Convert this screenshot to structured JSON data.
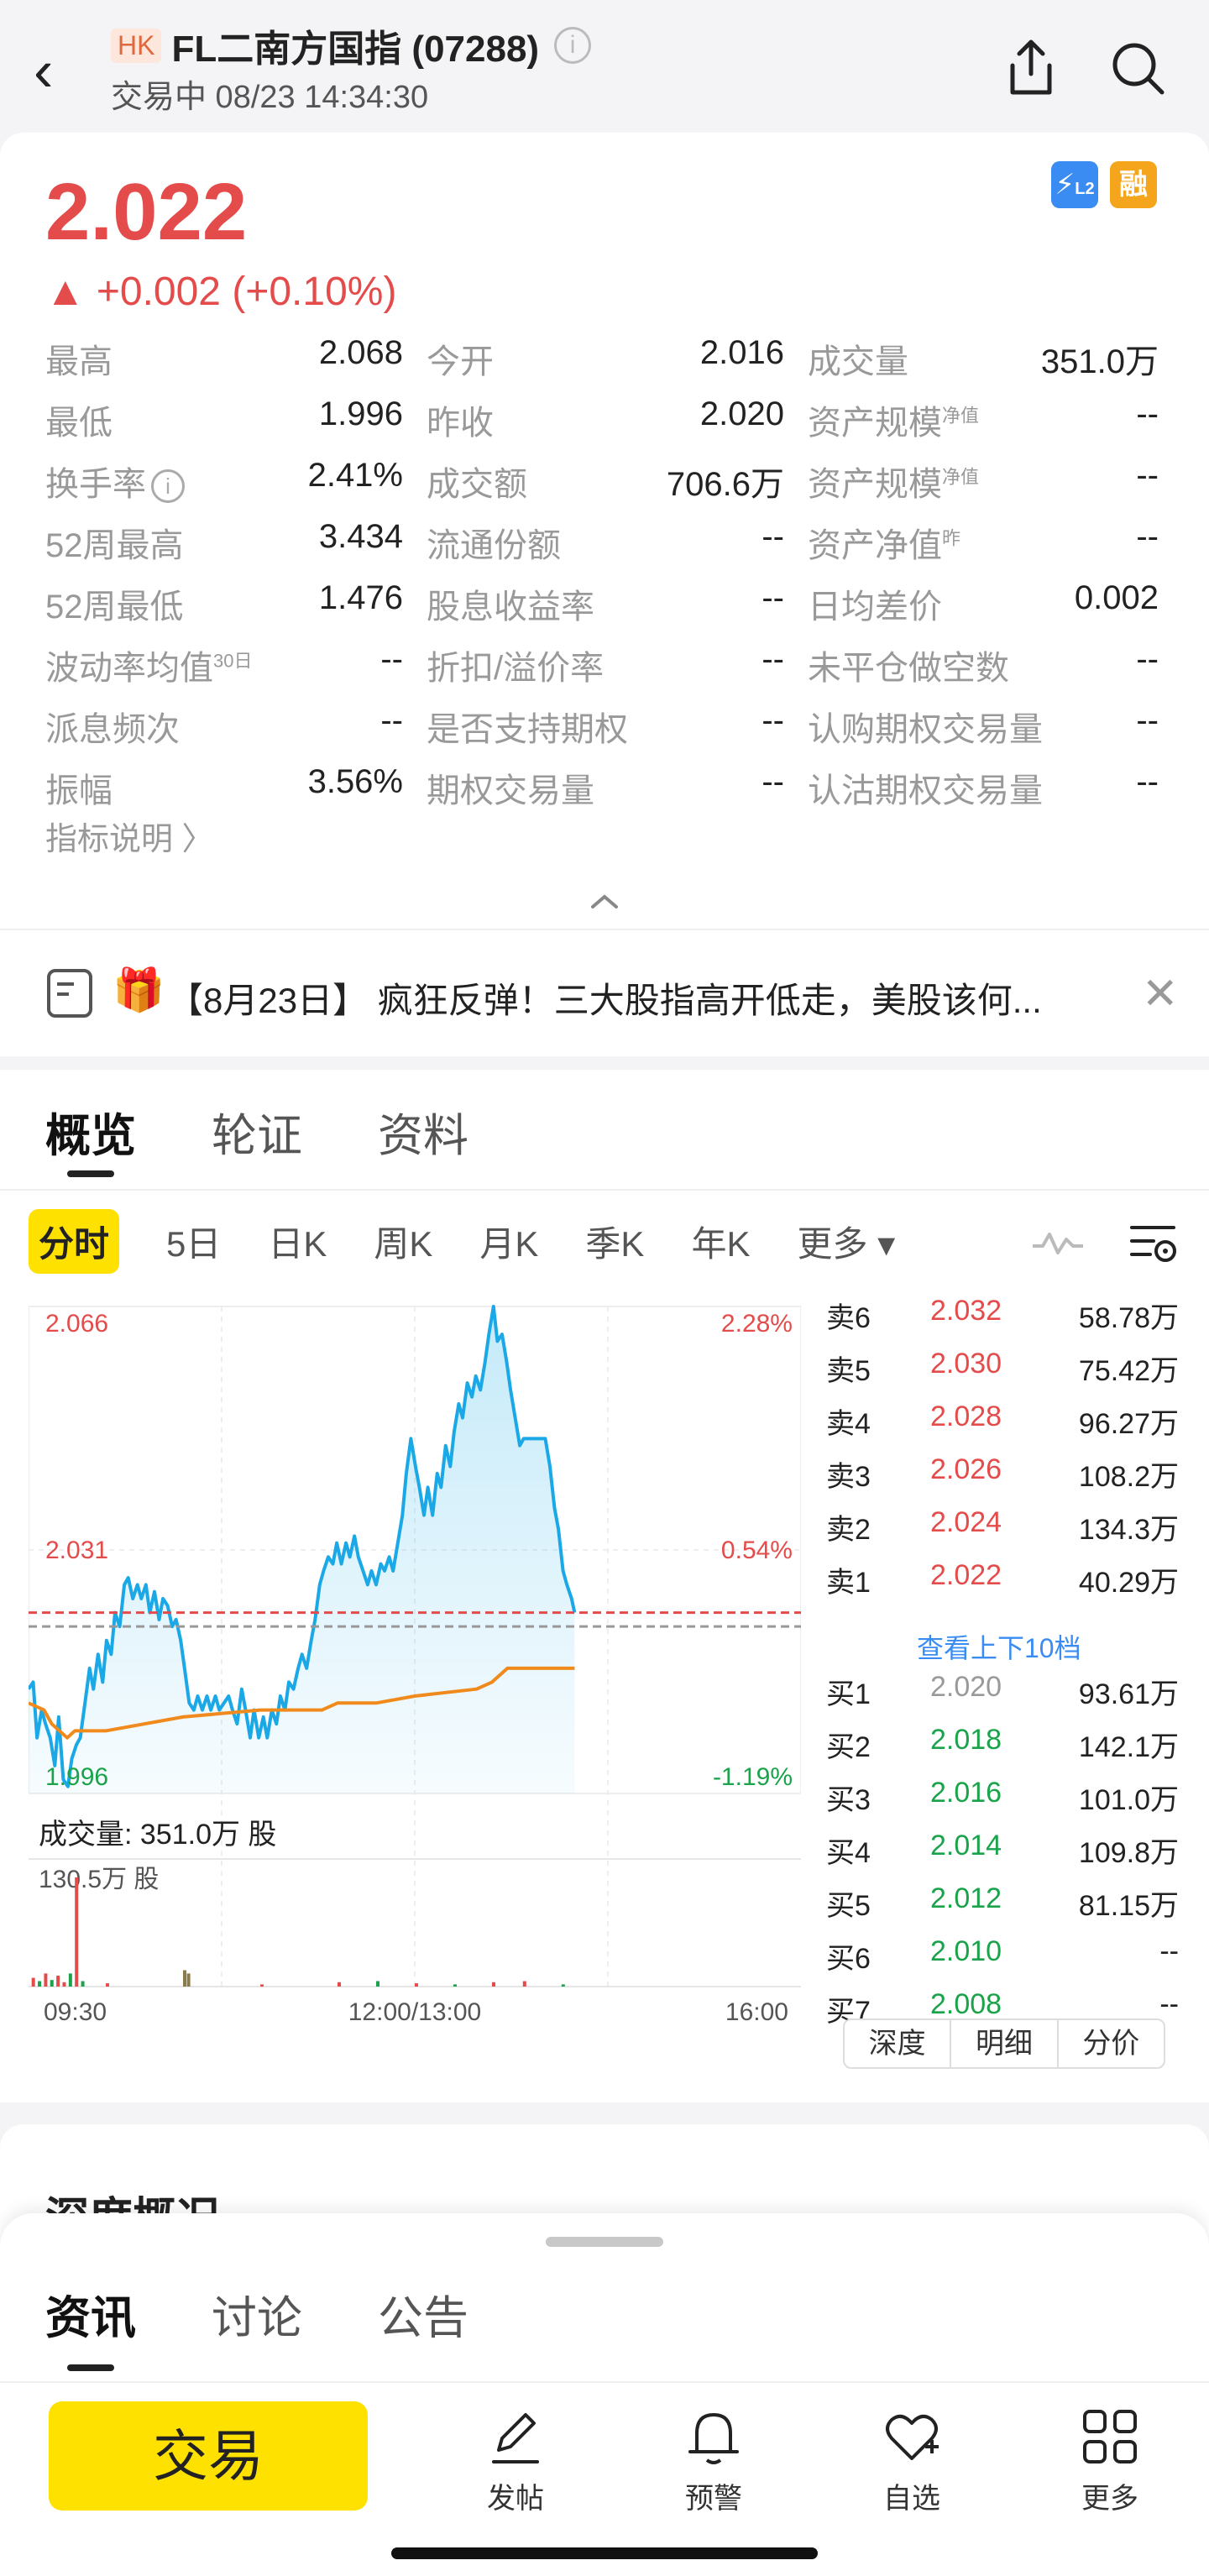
{
  "header": {
    "market_badge": "HK",
    "title": "FL二南方国指 (07288)",
    "status": "交易中 08/23 14:34:30"
  },
  "quote": {
    "price": "2.022",
    "change": "▲ +0.002 (+0.10%)",
    "badge_l2": "L2",
    "badge_margin": "融",
    "color_up": "#e44b4b",
    "color_down": "#1aa34a"
  },
  "stats": [
    [
      {
        "label": "最高",
        "value": "2.068"
      },
      {
        "label": "今开",
        "value": "2.016"
      },
      {
        "label": "成交量",
        "value": "351.0万"
      }
    ],
    [
      {
        "label": "最低",
        "value": "1.996"
      },
      {
        "label": "昨收",
        "value": "2.020"
      },
      {
        "label": "资产规模",
        "sup": "净值",
        "value": "--"
      }
    ],
    [
      {
        "label": "换手率",
        "value": "2.41%"
      },
      {
        "label": "成交额",
        "value": "706.6万"
      },
      {
        "label": "资产规模",
        "sup": "净值",
        "value": "--"
      }
    ],
    [
      {
        "label": "52周最高",
        "value": "3.434"
      },
      {
        "label": "流通份额",
        "value": "--"
      },
      {
        "label": "资产净值",
        "sup": "昨",
        "value": "--"
      }
    ],
    [
      {
        "label": "52周最低",
        "value": "1.476"
      },
      {
        "label": "股息收益率",
        "value": "--"
      },
      {
        "label": "日均差价",
        "value": "0.002"
      }
    ],
    [
      {
        "label": "波动率均值",
        "sup": "30日",
        "value": "--"
      },
      {
        "label": "折扣/溢价率",
        "value": "--"
      },
      {
        "label": "未平仓做空数",
        "value": "--"
      }
    ],
    [
      {
        "label": "派息频次",
        "value": "--"
      },
      {
        "label": "是否支持期权",
        "value": "--"
      },
      {
        "label": "认购期权交易量",
        "value": "--"
      }
    ],
    [
      {
        "label": "振幅",
        "value": "3.56%"
      },
      {
        "label": "期权交易量",
        "value": "--"
      },
      {
        "label": "认沽期权交易量",
        "value": "--"
      }
    ]
  ],
  "indicator_link": "指标说明 〉",
  "news": {
    "text": "【8月23日】 疯狂反弹！三大股指高开低走，美股该何..."
  },
  "tabs": [
    "概览",
    "轮证",
    "资料"
  ],
  "periods": [
    "分时",
    "5日",
    "日K",
    "周K",
    "月K",
    "季K",
    "年K"
  ],
  "period_more": "更多 ▾",
  "chart_data": {
    "type": "line",
    "title": "",
    "price_axis": {
      "max": "2.066",
      "mid": "2.031",
      "min": "1.996"
    },
    "pct_axis": {
      "max": "2.28%",
      "mid": "0.54%",
      "min": "-1.19%"
    },
    "ylim": [
      1.996,
      2.066
    ],
    "prev_close": 2.02,
    "current": 2.022,
    "x_ticks": [
      "09:30",
      "12:00/13:00",
      "16:00"
    ],
    "volume_label": "成交量: 351.0万 股",
    "volume_max_label": "130.5万 股",
    "price_series": [
      [
        0,
        2.011
      ],
      [
        0.006,
        2.012
      ],
      [
        0.011,
        2.004
      ],
      [
        0.017,
        2.008
      ],
      [
        0.022,
        2.006
      ],
      [
        0.028,
        2.004
      ],
      [
        0.034,
        2.0
      ],
      [
        0.039,
        2.007
      ],
      [
        0.045,
        1.998
      ],
      [
        0.051,
        1.997
      ],
      [
        0.056,
        2.001
      ],
      [
        0.062,
        2.003
      ],
      [
        0.067,
        2.004
      ],
      [
        0.073,
        2.009
      ],
      [
        0.079,
        2.014
      ],
      [
        0.084,
        2.011
      ],
      [
        0.09,
        2.016
      ],
      [
        0.096,
        2.012
      ],
      [
        0.101,
        2.018
      ],
      [
        0.107,
        2.016
      ],
      [
        0.112,
        2.022
      ],
      [
        0.118,
        2.02
      ],
      [
        0.124,
        2.026
      ],
      [
        0.129,
        2.027
      ],
      [
        0.135,
        2.024
      ],
      [
        0.141,
        2.026
      ],
      [
        0.146,
        2.024
      ],
      [
        0.152,
        2.026
      ],
      [
        0.157,
        2.022
      ],
      [
        0.163,
        2.025
      ],
      [
        0.169,
        2.021
      ],
      [
        0.174,
        2.024
      ],
      [
        0.18,
        2.023
      ],
      [
        0.186,
        2.02
      ],
      [
        0.191,
        2.021
      ],
      [
        0.197,
        2.018
      ],
      [
        0.202,
        2.014
      ],
      [
        0.208,
        2.009
      ],
      [
        0.214,
        2.008
      ],
      [
        0.219,
        2.01
      ],
      [
        0.225,
        2.008
      ],
      [
        0.231,
        2.01
      ],
      [
        0.236,
        2.008
      ],
      [
        0.242,
        2.01
      ],
      [
        0.247,
        2.008
      ],
      [
        0.253,
        2.009
      ],
      [
        0.259,
        2.01
      ],
      [
        0.264,
        2.008
      ],
      [
        0.27,
        2.006
      ],
      [
        0.276,
        2.011
      ],
      [
        0.281,
        2.008
      ],
      [
        0.287,
        2.004
      ],
      [
        0.292,
        2.008
      ],
      [
        0.298,
        2.004
      ],
      [
        0.304,
        2.007
      ],
      [
        0.309,
        2.004
      ],
      [
        0.315,
        2.008
      ],
      [
        0.321,
        2.006
      ],
      [
        0.326,
        2.01
      ],
      [
        0.332,
        2.008
      ],
      [
        0.337,
        2.012
      ],
      [
        0.343,
        2.011
      ],
      [
        0.349,
        2.014
      ],
      [
        0.354,
        2.016
      ],
      [
        0.36,
        2.014
      ],
      [
        0.366,
        2.018
      ],
      [
        0.371,
        2.021
      ],
      [
        0.377,
        2.026
      ],
      [
        0.382,
        2.028
      ],
      [
        0.388,
        2.03
      ],
      [
        0.394,
        2.029
      ],
      [
        0.399,
        2.032
      ],
      [
        0.405,
        2.029
      ],
      [
        0.411,
        2.032
      ],
      [
        0.416,
        2.03
      ],
      [
        0.422,
        2.033
      ],
      [
        0.427,
        2.03
      ],
      [
        0.433,
        2.028
      ],
      [
        0.439,
        2.026
      ],
      [
        0.444,
        2.028
      ],
      [
        0.45,
        2.026
      ],
      [
        0.456,
        2.029
      ],
      [
        0.461,
        2.028
      ],
      [
        0.467,
        2.03
      ],
      [
        0.472,
        2.028
      ],
      [
        0.478,
        2.032
      ],
      [
        0.484,
        2.036
      ],
      [
        0.489,
        2.042
      ],
      [
        0.495,
        2.047
      ],
      [
        0.501,
        2.043
      ],
      [
        0.506,
        2.04
      ],
      [
        0.512,
        2.036
      ],
      [
        0.517,
        2.04
      ],
      [
        0.523,
        2.036
      ],
      [
        0.529,
        2.042
      ],
      [
        0.534,
        2.04
      ],
      [
        0.54,
        2.046
      ],
      [
        0.546,
        2.043
      ],
      [
        0.551,
        2.048
      ],
      [
        0.557,
        2.052
      ],
      [
        0.562,
        2.05
      ],
      [
        0.568,
        2.055
      ],
      [
        0.574,
        2.053
      ],
      [
        0.579,
        2.056
      ],
      [
        0.585,
        2.054
      ],
      [
        0.591,
        2.058
      ],
      [
        0.596,
        2.062
      ],
      [
        0.602,
        2.066
      ],
      [
        0.607,
        2.061
      ],
      [
        0.613,
        2.062
      ],
      [
        0.619,
        2.058
      ],
      [
        0.624,
        2.054
      ],
      [
        0.63,
        2.05
      ],
      [
        0.636,
        2.046
      ],
      [
        0.641,
        2.047
      ],
      [
        0.647,
        2.047
      ],
      [
        0.652,
        2.047
      ],
      [
        0.658,
        2.047
      ],
      [
        0.664,
        2.047
      ],
      [
        0.669,
        2.047
      ],
      [
        0.675,
        2.043
      ],
      [
        0.681,
        2.037
      ],
      [
        0.686,
        2.034
      ],
      [
        0.692,
        2.028
      ],
      [
        0.697,
        2.026
      ],
      [
        0.703,
        2.024
      ],
      [
        0.707,
        2.022
      ]
    ],
    "avg_series": [
      [
        0,
        2.009
      ],
      [
        0.02,
        2.008
      ],
      [
        0.03,
        2.006
      ],
      [
        0.05,
        2.004
      ],
      [
        0.06,
        2.005
      ],
      [
        0.1,
        2.005
      ],
      [
        0.2,
        2.007
      ],
      [
        0.3,
        2.008
      ],
      [
        0.38,
        2.008
      ],
      [
        0.4,
        2.009
      ],
      [
        0.45,
        2.009
      ],
      [
        0.5,
        2.01
      ],
      [
        0.58,
        2.011
      ],
      [
        0.6,
        2.012
      ],
      [
        0.62,
        2.014
      ],
      [
        0.707,
        2.014
      ]
    ],
    "volume_bars": [
      [
        0.004,
        0.08
      ],
      [
        0.012,
        0.05
      ],
      [
        0.02,
        0.12
      ],
      [
        0.028,
        0.06
      ],
      [
        0.036,
        0.1
      ],
      [
        0.044,
        0.04
      ],
      [
        0.052,
        0.12
      ],
      [
        0.06,
        1.0
      ],
      [
        0.068,
        0.05
      ],
      [
        0.1,
        0.03
      ],
      [
        0.2,
        0.15
      ],
      [
        0.205,
        0.12
      ],
      [
        0.3,
        0.02
      ],
      [
        0.4,
        0.04
      ],
      [
        0.45,
        0.05
      ],
      [
        0.5,
        0.03
      ],
      [
        0.55,
        0.02
      ],
      [
        0.6,
        0.04
      ],
      [
        0.64,
        0.05
      ],
      [
        0.69,
        0.02
      ]
    ]
  },
  "order_book": {
    "asks": [
      {
        "label": "卖6",
        "price": "2.032",
        "vol": "58.78万"
      },
      {
        "label": "卖5",
        "price": "2.030",
        "vol": "75.42万"
      },
      {
        "label": "卖4",
        "price": "2.028",
        "vol": "96.27万"
      },
      {
        "label": "卖3",
        "price": "2.026",
        "vol": "108.2万"
      },
      {
        "label": "卖2",
        "price": "2.024",
        "vol": "134.3万"
      },
      {
        "label": "卖1",
        "price": "2.022",
        "vol": "40.29万"
      }
    ],
    "more_link": "查看上下10档",
    "bids": [
      {
        "label": "买1",
        "price": "2.020",
        "vol": "93.61万",
        "flat": true
      },
      {
        "label": "买2",
        "price": "2.018",
        "vol": "142.1万"
      },
      {
        "label": "买3",
        "price": "2.016",
        "vol": "101.0万"
      },
      {
        "label": "买4",
        "price": "2.014",
        "vol": "109.8万"
      },
      {
        "label": "买5",
        "price": "2.012",
        "vol": "81.15万"
      },
      {
        "label": "买6",
        "price": "2.010",
        "vol": "--"
      },
      {
        "label": "买7",
        "price": "2.008",
        "vol": "--"
      }
    ],
    "tabs": [
      "深度",
      "明细",
      "分价"
    ]
  },
  "lower_section_title": "深度概况",
  "sheet": {
    "tabs": [
      "资讯",
      "讨论",
      "公告"
    ]
  },
  "bottom_nav": {
    "trade": "交易",
    "items": [
      {
        "label": "发帖",
        "icon": "pen-icon"
      },
      {
        "label": "预警",
        "icon": "bell-icon"
      },
      {
        "label": "自选",
        "icon": "heart-plus-icon"
      },
      {
        "label": "更多",
        "icon": "grid-icon"
      }
    ]
  }
}
